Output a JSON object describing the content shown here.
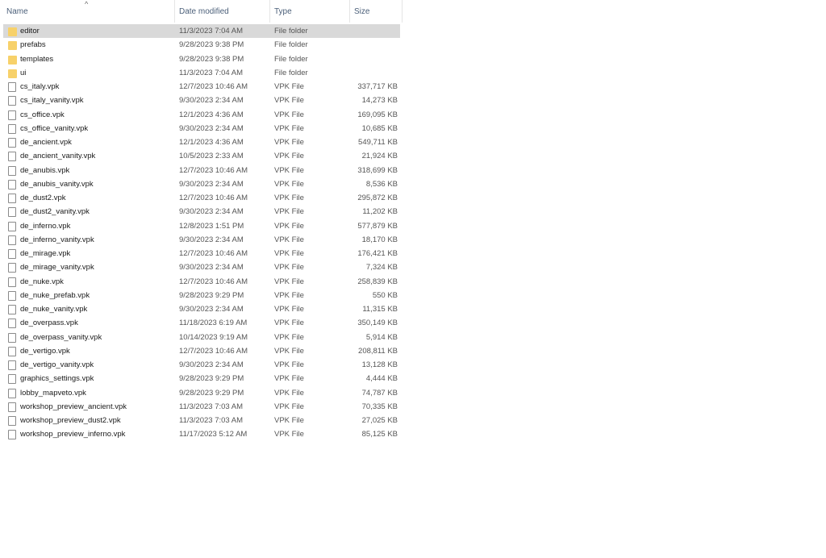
{
  "columns": {
    "name": "Name",
    "date": "Date modified",
    "type": "Type",
    "size": "Size",
    "sort_indicator": "^"
  },
  "selected_index": 0,
  "files": [
    {
      "name": "editor",
      "date": "11/3/2023 7:04 AM",
      "type": "File folder",
      "size": "",
      "icon": "folder-icon"
    },
    {
      "name": "prefabs",
      "date": "9/28/2023 9:38 PM",
      "type": "File folder",
      "size": "",
      "icon": "folder-icon"
    },
    {
      "name": "templates",
      "date": "9/28/2023 9:38 PM",
      "type": "File folder",
      "size": "",
      "icon": "folder-icon"
    },
    {
      "name": "ui",
      "date": "11/3/2023 7:04 AM",
      "type": "File folder",
      "size": "",
      "icon": "folder-icon"
    },
    {
      "name": "cs_italy.vpk",
      "date": "12/7/2023 10:46 AM",
      "type": "VPK File",
      "size": "337,717 KB",
      "icon": "file-icon"
    },
    {
      "name": "cs_italy_vanity.vpk",
      "date": "9/30/2023 2:34 AM",
      "type": "VPK File",
      "size": "14,273 KB",
      "icon": "file-icon"
    },
    {
      "name": "cs_office.vpk",
      "date": "12/1/2023 4:36 AM",
      "type": "VPK File",
      "size": "169,095 KB",
      "icon": "file-icon"
    },
    {
      "name": "cs_office_vanity.vpk",
      "date": "9/30/2023 2:34 AM",
      "type": "VPK File",
      "size": "10,685 KB",
      "icon": "file-icon"
    },
    {
      "name": "de_ancient.vpk",
      "date": "12/1/2023 4:36 AM",
      "type": "VPK File",
      "size": "549,711 KB",
      "icon": "file-icon"
    },
    {
      "name": "de_ancient_vanity.vpk",
      "date": "10/5/2023 2:33 AM",
      "type": "VPK File",
      "size": "21,924 KB",
      "icon": "file-icon"
    },
    {
      "name": "de_anubis.vpk",
      "date": "12/7/2023 10:46 AM",
      "type": "VPK File",
      "size": "318,699 KB",
      "icon": "file-icon"
    },
    {
      "name": "de_anubis_vanity.vpk",
      "date": "9/30/2023 2:34 AM",
      "type": "VPK File",
      "size": "8,536 KB",
      "icon": "file-icon"
    },
    {
      "name": "de_dust2.vpk",
      "date": "12/7/2023 10:46 AM",
      "type": "VPK File",
      "size": "295,872 KB",
      "icon": "file-icon"
    },
    {
      "name": "de_dust2_vanity.vpk",
      "date": "9/30/2023 2:34 AM",
      "type": "VPK File",
      "size": "11,202 KB",
      "icon": "file-icon"
    },
    {
      "name": "de_inferno.vpk",
      "date": "12/8/2023 1:51 PM",
      "type": "VPK File",
      "size": "577,879 KB",
      "icon": "file-icon"
    },
    {
      "name": "de_inferno_vanity.vpk",
      "date": "9/30/2023 2:34 AM",
      "type": "VPK File",
      "size": "18,170 KB",
      "icon": "file-icon"
    },
    {
      "name": "de_mirage.vpk",
      "date": "12/7/2023 10:46 AM",
      "type": "VPK File",
      "size": "176,421 KB",
      "icon": "file-icon"
    },
    {
      "name": "de_mirage_vanity.vpk",
      "date": "9/30/2023 2:34 AM",
      "type": "VPK File",
      "size": "7,324 KB",
      "icon": "file-icon"
    },
    {
      "name": "de_nuke.vpk",
      "date": "12/7/2023 10:46 AM",
      "type": "VPK File",
      "size": "258,839 KB",
      "icon": "file-icon"
    },
    {
      "name": "de_nuke_prefab.vpk",
      "date": "9/28/2023 9:29 PM",
      "type": "VPK File",
      "size": "550 KB",
      "icon": "file-icon"
    },
    {
      "name": "de_nuke_vanity.vpk",
      "date": "9/30/2023 2:34 AM",
      "type": "VPK File",
      "size": "11,315 KB",
      "icon": "file-icon"
    },
    {
      "name": "de_overpass.vpk",
      "date": "11/18/2023 6:19 AM",
      "type": "VPK File",
      "size": "350,149 KB",
      "icon": "file-icon"
    },
    {
      "name": "de_overpass_vanity.vpk",
      "date": "10/14/2023 9:19 AM",
      "type": "VPK File",
      "size": "5,914 KB",
      "icon": "file-icon"
    },
    {
      "name": "de_vertigo.vpk",
      "date": "12/7/2023 10:46 AM",
      "type": "VPK File",
      "size": "208,811 KB",
      "icon": "file-icon"
    },
    {
      "name": "de_vertigo_vanity.vpk",
      "date": "9/30/2023 2:34 AM",
      "type": "VPK File",
      "size": "13,128 KB",
      "icon": "file-icon"
    },
    {
      "name": "graphics_settings.vpk",
      "date": "9/28/2023 9:29 PM",
      "type": "VPK File",
      "size": "4,444 KB",
      "icon": "file-icon"
    },
    {
      "name": "lobby_mapveto.vpk",
      "date": "9/28/2023 9:29 PM",
      "type": "VPK File",
      "size": "74,787 KB",
      "icon": "file-icon"
    },
    {
      "name": "workshop_preview_ancient.vpk",
      "date": "11/3/2023 7:03 AM",
      "type": "VPK File",
      "size": "70,335 KB",
      "icon": "file-icon"
    },
    {
      "name": "workshop_preview_dust2.vpk",
      "date": "11/3/2023 7:03 AM",
      "type": "VPK File",
      "size": "27,025 KB",
      "icon": "file-icon"
    },
    {
      "name": "workshop_preview_inferno.vpk",
      "date": "11/17/2023 5:12 AM",
      "type": "VPK File",
      "size": "85,125 KB",
      "icon": "file-icon"
    }
  ]
}
